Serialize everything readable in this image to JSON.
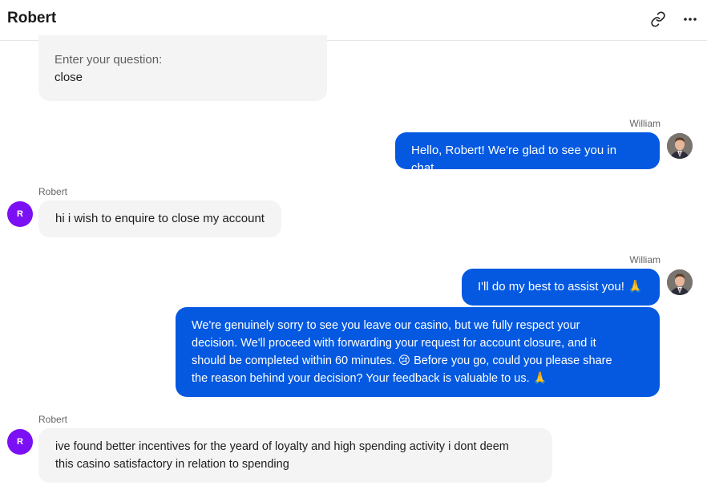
{
  "header": {
    "title": "Robert"
  },
  "messages": {
    "m0": {
      "label": "Enter your question:",
      "text": "close"
    },
    "m1": {
      "sender": "William",
      "text": "Hello, Robert! We're glad to see you in chat."
    },
    "m2": {
      "sender": "Robert",
      "avatar_initial": "R",
      "text": "hi i wish to enquire to close my account"
    },
    "m3": {
      "sender": "William",
      "text": "I'll do my best to assist you! 🙏"
    },
    "m4": {
      "line1": "We're genuinely sorry to see you leave our casino, but we fully respect your",
      "line2": "decision. We'll proceed with forwarding your request for account closure, and it",
      "line3": "should be completed within 60 minutes. 😢 Before you go, could you please share",
      "line4": "the reason behind your decision? Your feedback is valuable to us. 🙏"
    },
    "m5": {
      "sender": "Robert",
      "avatar_initial": "R",
      "line1": "ive found better incentives for the yeard of loyalty and high spending activity i dont deem",
      "line2": "this casino satisfactory in relation to spending"
    }
  },
  "icons": {
    "link": "link-icon",
    "more": "more-dots-icon"
  },
  "colors": {
    "agent_bubble": "#0459e0",
    "user_bubble": "#f4f4f4",
    "user_avatar": "#7b10f5"
  }
}
